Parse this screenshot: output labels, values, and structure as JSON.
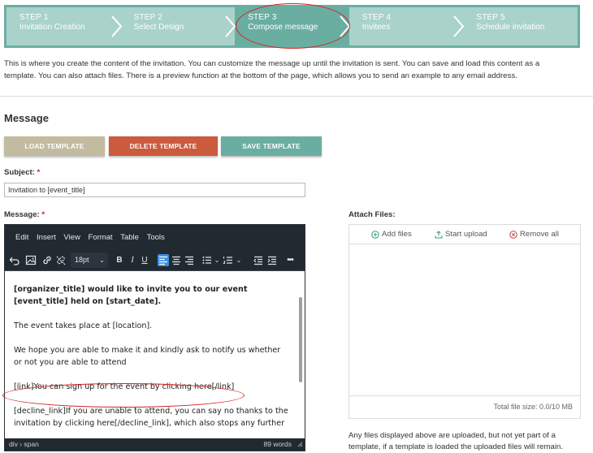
{
  "steps": [
    {
      "num": "STEP 1",
      "name": "Invitation Creation",
      "active": false
    },
    {
      "num": "STEP 2",
      "name": "Select Design",
      "active": false
    },
    {
      "num": "STEP 3",
      "name": "Compose message",
      "active": true
    },
    {
      "num": "STEP 4",
      "name": "Invitees",
      "active": false
    },
    {
      "num": "STEP 5",
      "name": "Schedule invitation",
      "active": false
    }
  ],
  "intro": "This is where you create the content of the invitation. You can customize the message up until the invitation is sent. You can save and load this content as a template. You can also attach files. There is a preview function at the bottom of the page, which allows you to send an example to any email address.",
  "section_title": "Message",
  "buttons": {
    "load": "LOAD TEMPLATE",
    "delete": "DELETE TEMPLATE",
    "save": "SAVE TEMPLATE"
  },
  "subject": {
    "label": "Subject:",
    "required": "*",
    "value": "Invitation to [event_title]"
  },
  "message": {
    "label": "Message:",
    "required": "*"
  },
  "editor": {
    "menu": [
      "Edit",
      "Insert",
      "View",
      "Format",
      "Table",
      "Tools"
    ],
    "font_size": "18pt",
    "paragraphs": [
      "[organizer_title] would like to invite you to our event [event_title] held on [start_date].",
      "The event takes place at [location].",
      "",
      "We hope you are able to make it and kindly ask to notify us whether or not you are able to attend",
      "[link]You can sign up for the event by clicking here[/link]",
      "[decline_link]If you are unable to attend, you can say no thanks to the invitation by clicking here[/decline_link], which also stops any further"
    ],
    "path": "div › span",
    "word_count": "89 words"
  },
  "attach": {
    "label": "Attach Files:",
    "add": "Add files",
    "start": "Start upload",
    "remove": "Remove all",
    "total": "Total file size: 0.0/10 MB",
    "note": "Any files displayed above are uploaded, but not yet part of a template, if a template is loaded the uploaded files will remain."
  },
  "colors": {
    "accent": "#6aaea2",
    "step_inactive": "#a9d2cb",
    "load_button": "#c2bba0",
    "delete_button": "#cc5a3d",
    "save_button": "#6aaea2",
    "editor_dark": "#222a31",
    "annotation": "#d42222"
  },
  "icons": {
    "add": "plus-circle-icon",
    "start": "upload-icon",
    "remove": "x-circle-icon",
    "step_separator": "chevron-right-icon"
  }
}
